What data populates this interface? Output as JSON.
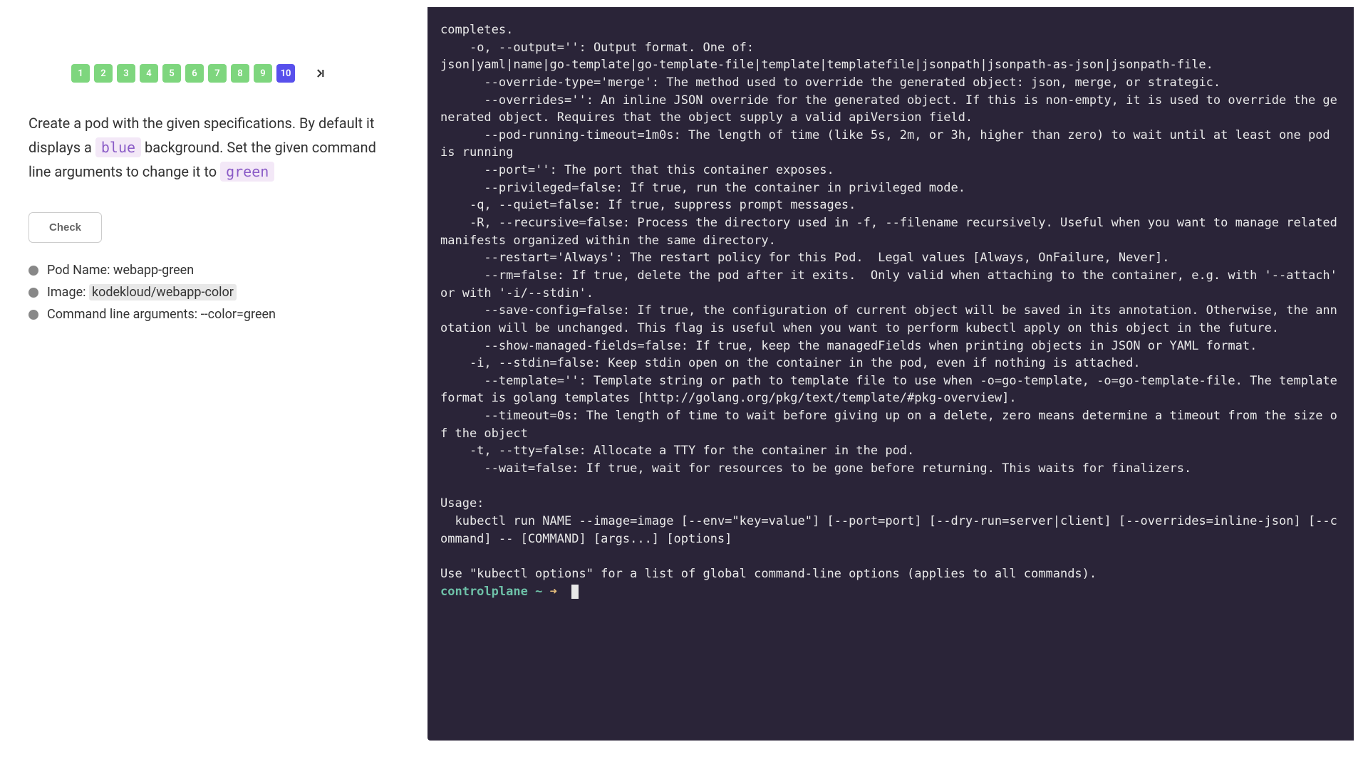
{
  "nav": {
    "steps": [
      "1",
      "2",
      "3",
      "4",
      "5",
      "6",
      "7",
      "8",
      "9",
      "10"
    ],
    "current_index": 9
  },
  "task": {
    "prefix": "Create a pod with the given specifications. By default it displays a ",
    "chip1": "blue",
    "mid": " background. Set the given command line arguments to change it to ",
    "chip2": "green"
  },
  "check_label": "Check",
  "requirements": [
    {
      "label_prefix": "Pod Name: ",
      "label_val": "webapp-green",
      "hl": false
    },
    {
      "label_prefix": "Image: ",
      "label_val": "kodekloud/webapp-color",
      "hl": true
    },
    {
      "label_prefix": "Command line arguments: ",
      "label_val": "--color=green",
      "hl": false
    }
  ],
  "terminal": {
    "output": "completes.\n    -o, --output='': Output format. One of:\njson|yaml|name|go-template|go-template-file|template|templatefile|jsonpath|jsonpath-as-json|jsonpath-file.\n      --override-type='merge': The method used to override the generated object: json, merge, or strategic.\n      --overrides='': An inline JSON override for the generated object. If this is non-empty, it is used to override the generated object. Requires that the object supply a valid apiVersion field.\n      --pod-running-timeout=1m0s: The length of time (like 5s, 2m, or 3h, higher than zero) to wait until at least one pod is running\n      --port='': The port that this container exposes.\n      --privileged=false: If true, run the container in privileged mode.\n    -q, --quiet=false: If true, suppress prompt messages.\n    -R, --recursive=false: Process the directory used in -f, --filename recursively. Useful when you want to manage related manifests organized within the same directory.\n      --restart='Always': The restart policy for this Pod.  Legal values [Always, OnFailure, Never].\n      --rm=false: If true, delete the pod after it exits.  Only valid when attaching to the container, e.g. with '--attach' or with '-i/--stdin'.\n      --save-config=false: If true, the configuration of current object will be saved in its annotation. Otherwise, the annotation will be unchanged. This flag is useful when you want to perform kubectl apply on this object in the future.\n      --show-managed-fields=false: If true, keep the managedFields when printing objects in JSON or YAML format.\n    -i, --stdin=false: Keep stdin open on the container in the pod, even if nothing is attached.\n      --template='': Template string or path to template file to use when -o=go-template, -o=go-template-file. The template format is golang templates [http://golang.org/pkg/text/template/#pkg-overview].\n      --timeout=0s: The length of time to wait before giving up on a delete, zero means determine a timeout from the size of the object\n    -t, --tty=false: Allocate a TTY for the container in the pod.\n      --wait=false: If true, wait for resources to be gone before returning. This waits for finalizers.\n\nUsage:\n  kubectl run NAME --image=image [--env=\"key=value\"] [--port=port] [--dry-run=server|client] [--overrides=inline-json] [--command] -- [COMMAND] [args...] [options]\n\nUse \"kubectl options\" for a list of global command-line options (applies to all commands).\n",
    "prompt_host": "controlplane",
    "prompt_path": "~",
    "prompt_arrow": "➜"
  }
}
